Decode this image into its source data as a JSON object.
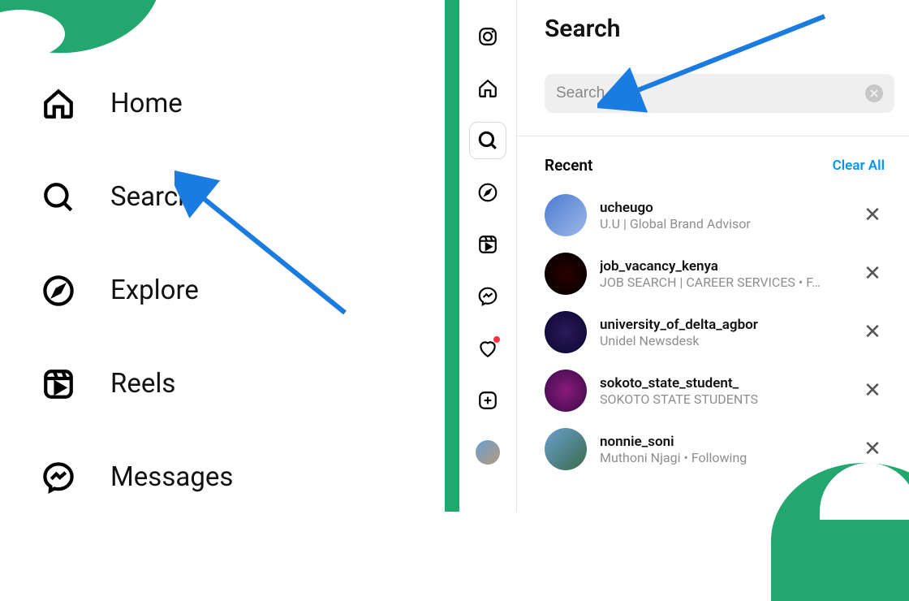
{
  "left_nav": {
    "items": [
      {
        "name": "home",
        "label": "Home"
      },
      {
        "name": "search",
        "label": "Search"
      },
      {
        "name": "explore",
        "label": "Explore"
      },
      {
        "name": "reels",
        "label": "Reels"
      },
      {
        "name": "messages",
        "label": "Messages"
      }
    ]
  },
  "rail": {
    "items": [
      {
        "name": "instagram-logo"
      },
      {
        "name": "home"
      },
      {
        "name": "search",
        "active": true
      },
      {
        "name": "explore"
      },
      {
        "name": "reels"
      },
      {
        "name": "messages"
      },
      {
        "name": "notifications",
        "dot": true
      },
      {
        "name": "create"
      },
      {
        "name": "profile"
      }
    ]
  },
  "search": {
    "title": "Search",
    "placeholder": "Search",
    "recent_label": "Recent",
    "clear_all_label": "Clear All",
    "results": [
      {
        "username": "ucheugo",
        "subtitle": "U.U | Global Brand Advisor"
      },
      {
        "username": "job_vacancy_kenya",
        "subtitle": "JOB SEARCH | CAREER SERVICES • F…"
      },
      {
        "username": "university_of_delta_agbor",
        "subtitle": "Unidel Newsdesk"
      },
      {
        "username": "sokoto_state_student_",
        "subtitle": "SOKOTO STATE STUDENTS"
      },
      {
        "username": "nonnie_soni",
        "subtitle": "Muthoni Njagi • Following"
      }
    ]
  },
  "colors": {
    "accent": "#0095f6",
    "brand_green": "#22a76f",
    "arrow": "#1a7be0"
  }
}
